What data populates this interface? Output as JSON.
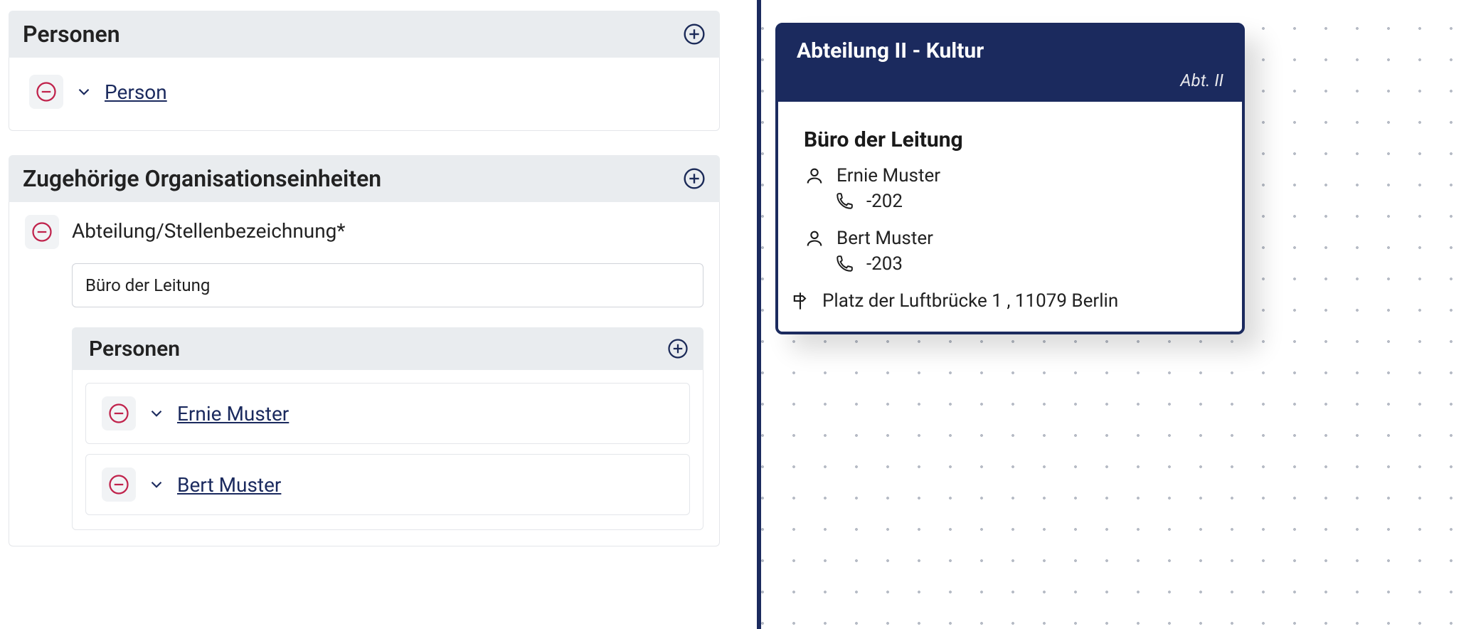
{
  "left": {
    "personen": {
      "title": "Personen",
      "items": [
        {
          "label": "Person"
        }
      ]
    },
    "orgunits": {
      "title": "Zugehörige Organisationseinheiten",
      "field_label": "Abteilung/Stellenbezeichnung*",
      "field_value": "Büro der Leitung",
      "personen_title": "Personen",
      "persons": [
        {
          "label": "Ernie Muster"
        },
        {
          "label": "Bert Muster"
        }
      ]
    }
  },
  "card": {
    "title": "Abteilung II - Kultur",
    "subtitle": "Abt. II",
    "section_title": "Büro der Leitung",
    "persons": [
      {
        "name": "Ernie Muster",
        "phone": "-202"
      },
      {
        "name": "Bert Muster",
        "phone": "-203"
      }
    ],
    "address": "Platz der Luftbrücke 1 , 11079 Berlin"
  }
}
